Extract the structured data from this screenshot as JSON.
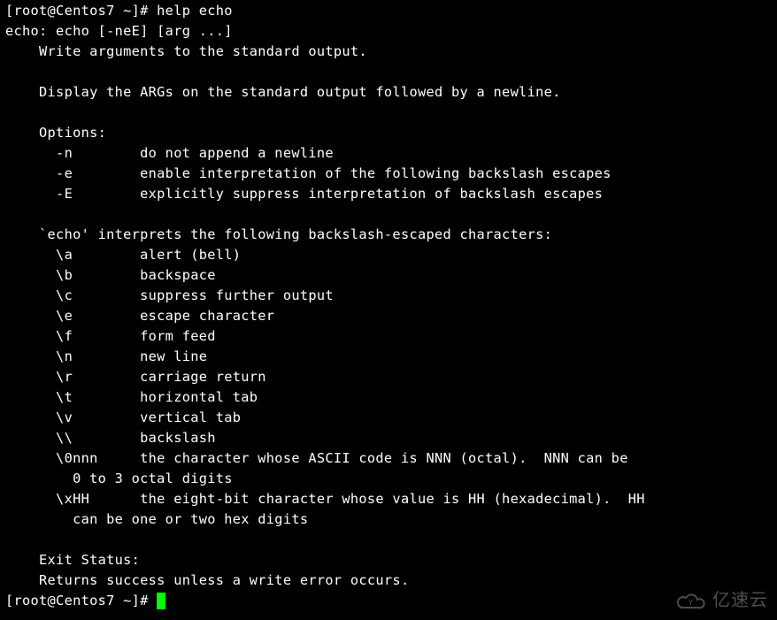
{
  "prompt": {
    "user": "root",
    "host": "Centos7",
    "cwd": "~",
    "symbol": "#",
    "full": "[root@Centos7 ~]# "
  },
  "command": "help echo",
  "output": {
    "synopsis": "echo: echo [-neE] [arg ...]",
    "summary": "    Write arguments to the standard output.",
    "blank1": "    ",
    "desc": "    Display the ARGs on the standard output followed by a newline.",
    "blank2": "    ",
    "opts_header": "    Options:",
    "opt_n": "      -n        do not append a newline",
    "opt_e": "      -e        enable interpretation of the following backslash escapes",
    "opt_E": "      -E        explicitly suppress interpretation of backslash escapes",
    "blank3": "    ",
    "esc_header": "    `echo' interprets the following backslash-escaped characters:",
    "esc_a": "      \\a        alert (bell)",
    "esc_b": "      \\b        backspace",
    "esc_c": "      \\c        suppress further output",
    "esc_e": "      \\e        escape character",
    "esc_f": "      \\f        form feed",
    "esc_n": "      \\n        new line",
    "esc_r": "      \\r        carriage return",
    "esc_t": "      \\t        horizontal tab",
    "esc_v": "      \\v        vertical tab",
    "esc_bs": "      \\\\        backslash",
    "esc_0n": "      \\0nnn     the character whose ASCII code is NNN (octal).  NNN can be",
    "esc_0n2": "        0 to 3 octal digits",
    "esc_xh": "      \\xHH      the eight-bit character whose value is HH (hexadecimal).  HH",
    "esc_xh2": "        can be one or two hex digits",
    "blank4": "    ",
    "exit_header": "    Exit Status:",
    "exit_text": "    Returns success unless a write error occurs."
  },
  "watermark_text": "亿速云"
}
